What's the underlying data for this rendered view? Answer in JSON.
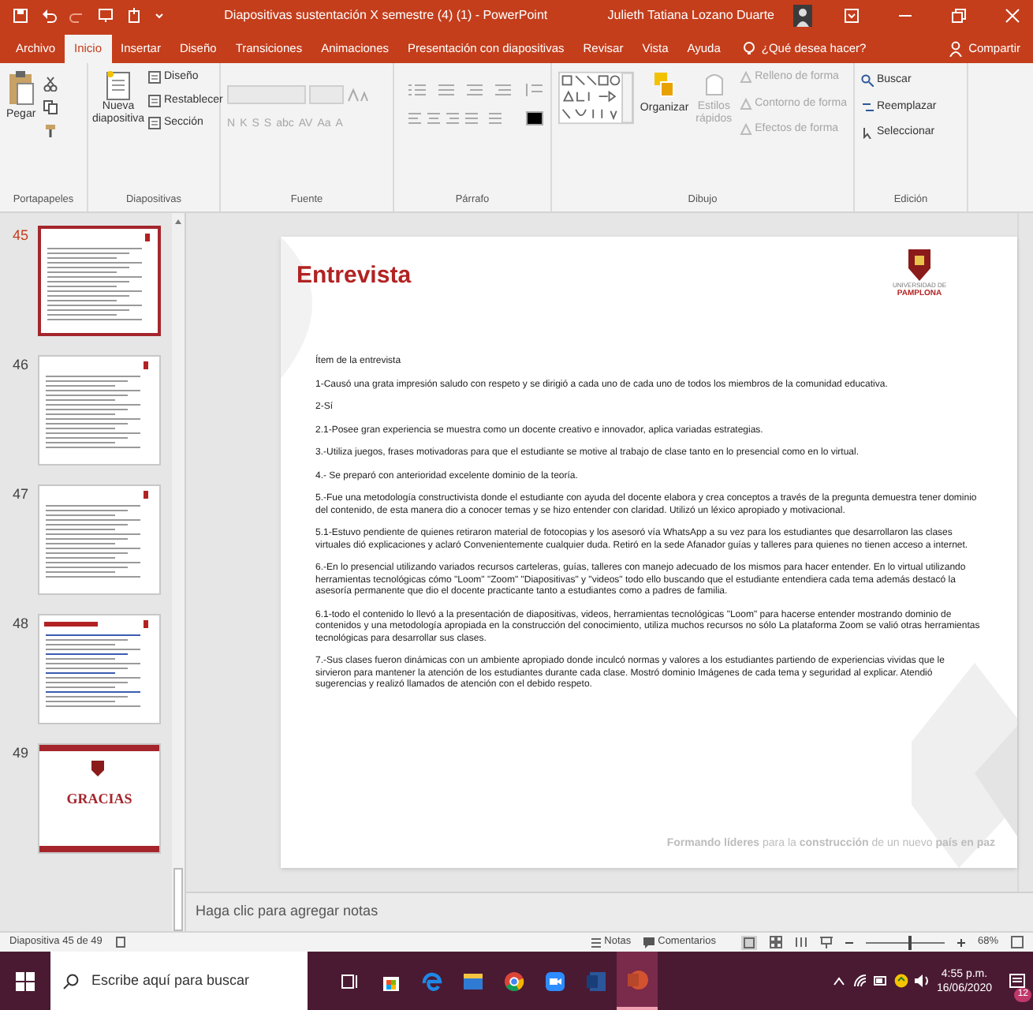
{
  "window": {
    "title": "Diapositivas sustentación X semestre (4) (1)  -  PowerPoint",
    "user": "Julieth Tatiana Lozano Duarte"
  },
  "tabs": [
    {
      "label": "Archivo",
      "selected": false
    },
    {
      "label": "Inicio",
      "selected": true
    },
    {
      "label": "Insertar",
      "selected": false
    },
    {
      "label": "Diseño",
      "selected": false
    },
    {
      "label": "Transiciones",
      "selected": false
    },
    {
      "label": "Animaciones",
      "selected": false
    },
    {
      "label": "Presentación con diapositivas",
      "selected": false
    },
    {
      "label": "Revisar",
      "selected": false
    },
    {
      "label": "Vista",
      "selected": false
    },
    {
      "label": "Ayuda",
      "selected": false
    }
  ],
  "tell_me": "¿Qué desea hacer?",
  "share": "Compartir",
  "ribbon": {
    "groups": [
      {
        "kind": "clipboard",
        "label": "Portapapeles",
        "buttons": [
          {
            "label": "Pegar",
            "disabled": false
          }
        ]
      },
      {
        "kind": "slides",
        "label": "Diapositivas",
        "buttons": [
          {
            "label": "Nueva diapositiva",
            "disabled": false
          },
          {
            "label": "Diseño",
            "disabled": false
          },
          {
            "label": "Restablecer",
            "disabled": false
          },
          {
            "label": "Sección",
            "disabled": false
          }
        ]
      },
      {
        "kind": "font",
        "label": "Fuente",
        "buttons": [
          {
            "label": "N",
            "disabled": true
          },
          {
            "label": "K",
            "disabled": true
          },
          {
            "label": "S",
            "disabled": true
          },
          {
            "label": "S",
            "disabled": true
          },
          {
            "label": "abc",
            "disabled": true
          },
          {
            "label": "AV",
            "disabled": true
          },
          {
            "label": "Aa",
            "disabled": true
          },
          {
            "label": "A",
            "disabled": true
          }
        ]
      },
      {
        "kind": "paragraph",
        "label": "Párrafo"
      },
      {
        "kind": "drawing",
        "label": "Dibujo",
        "buttons": [
          {
            "label": "Organizar",
            "disabled": false
          },
          {
            "label": "Estilos rápidos",
            "disabled": true
          },
          {
            "label": "Relleno de forma",
            "disabled": true
          },
          {
            "label": "Contorno de forma",
            "disabled": true
          },
          {
            "label": "Efectos de forma",
            "disabled": true
          }
        ]
      },
      {
        "kind": "editing",
        "label": "Edición",
        "buttons": [
          {
            "label": "Buscar",
            "disabled": false
          },
          {
            "label": "Reemplazar",
            "disabled": false
          },
          {
            "label": "Seleccionar",
            "disabled": false
          }
        ]
      }
    ]
  },
  "thumbnails": [
    {
      "number": "45",
      "kind": "text",
      "selected": true
    },
    {
      "number": "46",
      "kind": "text",
      "selected": false
    },
    {
      "number": "47",
      "kind": "text",
      "selected": false
    },
    {
      "number": "48",
      "kind": "heading",
      "selected": false
    },
    {
      "number": "49",
      "kind": "closing",
      "heading": "GRACIAS",
      "selected": false
    }
  ],
  "slide": {
    "title": "Entrevista",
    "logo_text": [
      "UNIVERSIDAD DE",
      "PAMPLONA"
    ],
    "paragraphs": [
      "Ítem de la entrevista",
      "1-Causó una grata impresión saludo con respeto y se dirigió a cada uno de cada uno de todos los miembros de la comunidad educativa.",
      "2-Sí",
      "2.1-Posee gran experiencia se muestra como un docente creativo e innovador, aplica variadas estrategias.",
      "3.-Utiliza juegos, frases motivadoras para que el estudiante se motive al trabajo de clase tanto  en lo presencial como en lo virtual.",
      "4.- Se preparó con anterioridad excelente dominio de la teoría.",
      "5.-Fue una metodología constructivista donde el estudiante con ayuda del docente elabora y crea conceptos a través de la pregunta demuestra tener dominio del contenido, de esta manera dio a conocer temas y se hizo entender con claridad. Utilizó un léxico apropiado y motivacional.",
      "5.1-Estuvo pendiente de quienes retiraron material de fotocopias y  los asesoró vía WhatsApp a su vez para los estudiantes que desarrollaron las clases virtuales dió explicaciones y aclaró Convenientemente cualquier duda. Retiró en la sede Afanador guías y talleres para quienes no tienen acceso a internet.",
      "6.-En lo presencial utilizando variados recursos carteleras, guías, talleres con manejo adecuado de los mismos para hacer entender. En lo virtual utilizando herramientas tecnológicas cómo  \"Loom\" \"Zoom\"  \"Diapositivas\" y \"videos\" todo ello buscando que el estudiante entendiera cada tema además destacó la asesoría permanente que dio el docente practicante tanto a estudiantes como a  padres de familia.",
      "6.1-todo el contenido lo llevó a la presentación de diapositivas, videos, herramientas tecnológicas \"Loom\" para hacerse entender mostrando dominio de contenidos y una metodología apropiada en la construcción del conocimiento, utiliza muchos recursos no sólo La plataforma Zoom se valió otras herramientas tecnológicas  para desarrollar sus clases.",
      "7.-Sus clases fueron dinámicas con un ambiente apropiado donde inculcó normas  y valores a los estudiantes partiendo de experiencias vividas que le sirvieron para mantener la atención de los estudiantes  durante cada clase. Mostró dominio Imágenes de cada tema y seguridad al explicar. Atendió sugerencias y realizó llamados de atención con el debido respeto."
    ],
    "footer": "**Formando líderes** para la **construcción** de un nuevo **país en paz**"
  },
  "notes": {
    "placeholder": "Haga clic para agregar notas"
  },
  "status_bar": {
    "slide_count": "Diapositiva 45 de 49",
    "notes": "Notas",
    "comments": "Comentarios",
    "zoom": "68%",
    "level": 0.55
  },
  "taskbar": {
    "search": {
      "placeholder": "Escribe aquí para buscar"
    },
    "apps": [
      {
        "kind": "task_view",
        "selected": false
      },
      {
        "kind": "store",
        "selected": false
      },
      {
        "kind": "edge",
        "selected": false
      },
      {
        "kind": "folder",
        "selected": false
      },
      {
        "kind": "chrome",
        "selected": false
      },
      {
        "kind": "zoom",
        "selected": false
      },
      {
        "kind": "word",
        "selected": false
      },
      {
        "kind": "powerpoint",
        "selected": true
      }
    ],
    "time": "4:55 p.m.",
    "date": "16/06/2020",
    "notifications": "12"
  }
}
